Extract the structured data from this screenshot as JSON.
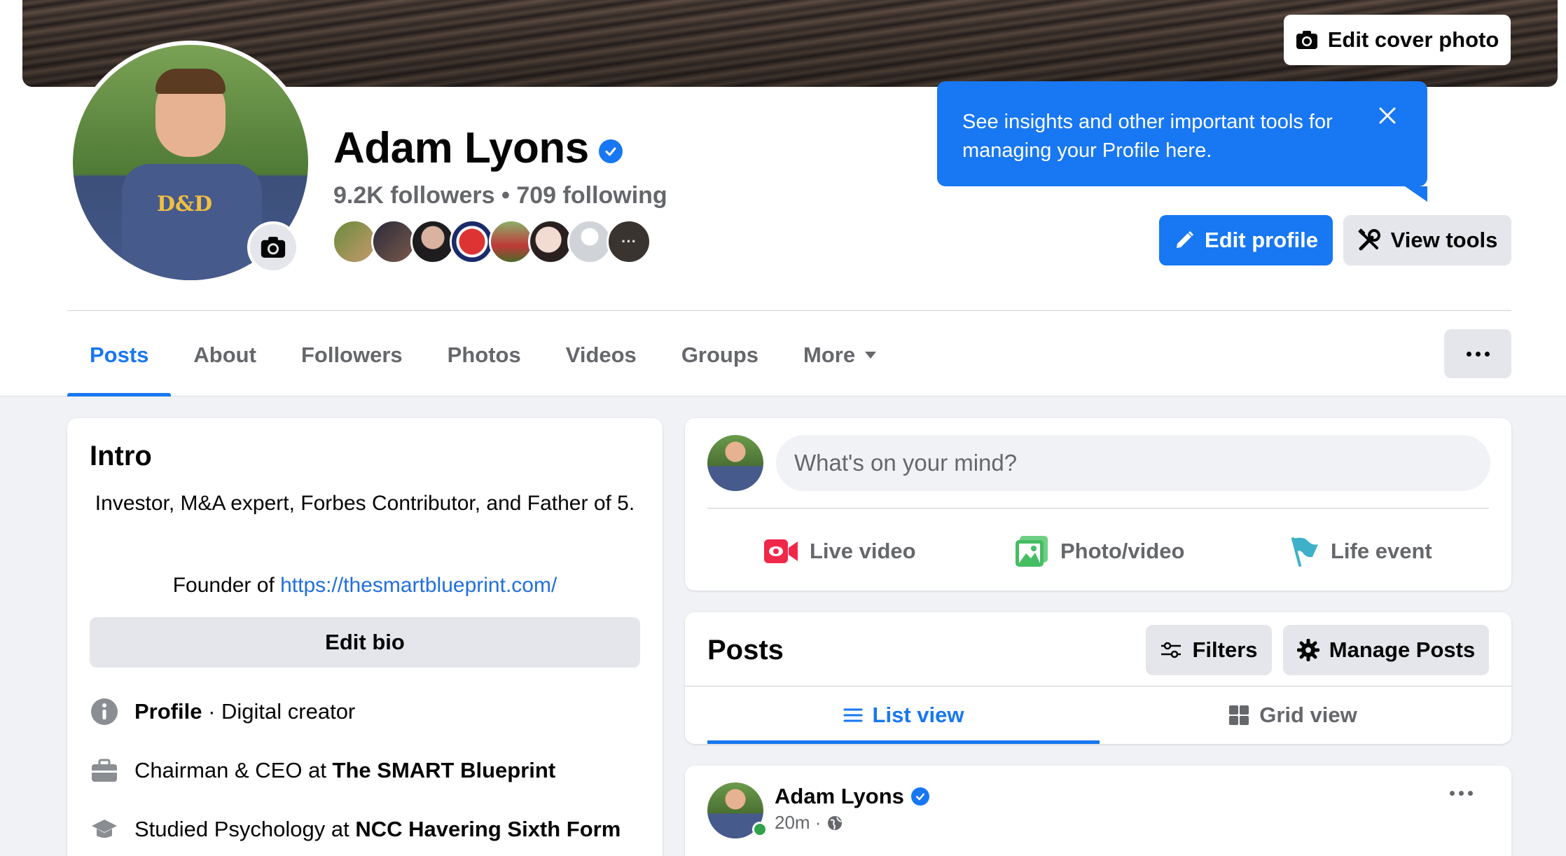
{
  "cover": {
    "edit_label": "Edit cover photo"
  },
  "profile": {
    "name": "Adam Lyons",
    "followers": "9.2K followers",
    "separator": "•",
    "following": "709 following"
  },
  "tooltip": {
    "text": "See insights and other important tools for managing your Profile here."
  },
  "actions": {
    "edit_profile": "Edit profile",
    "view_tools": "View tools"
  },
  "tabs": [
    {
      "label": "Posts",
      "active": true
    },
    {
      "label": "About"
    },
    {
      "label": "Followers"
    },
    {
      "label": "Photos"
    },
    {
      "label": "Videos"
    },
    {
      "label": "Groups"
    },
    {
      "label": "More"
    }
  ],
  "intro": {
    "title": "Intro",
    "bio": "Investor, M&A expert, Forbes Contributor, and Father of 5.",
    "founder_prefix": "Founder of ",
    "founder_link": "https://thesmartblueprint.com/",
    "edit_bio": "Edit bio",
    "items": [
      {
        "icon": "info-icon",
        "bold": "Profile",
        "text": " · Digital creator"
      },
      {
        "icon": "briefcase-icon",
        "prefix": "Chairman & CEO at ",
        "bold": "The SMART Blueprint"
      },
      {
        "icon": "graduation-cap-icon",
        "prefix": "Studied Psychology at ",
        "bold": "NCC Havering Sixth Form"
      }
    ]
  },
  "composer": {
    "placeholder": "What's on your mind?",
    "live_video": "Live video",
    "photo_video": "Photo/video",
    "life_event": "Life event"
  },
  "posts_header": {
    "title": "Posts",
    "filters": "Filters",
    "manage": "Manage Posts",
    "list_view": "List view",
    "grid_view": "Grid view"
  },
  "post": {
    "author": "Adam Lyons",
    "time": "20m ·"
  },
  "colors": {
    "accent": "#1877f2",
    "live_red": "#f02849",
    "photo_green": "#45bd62",
    "flag_teal": "#3db1c7"
  }
}
